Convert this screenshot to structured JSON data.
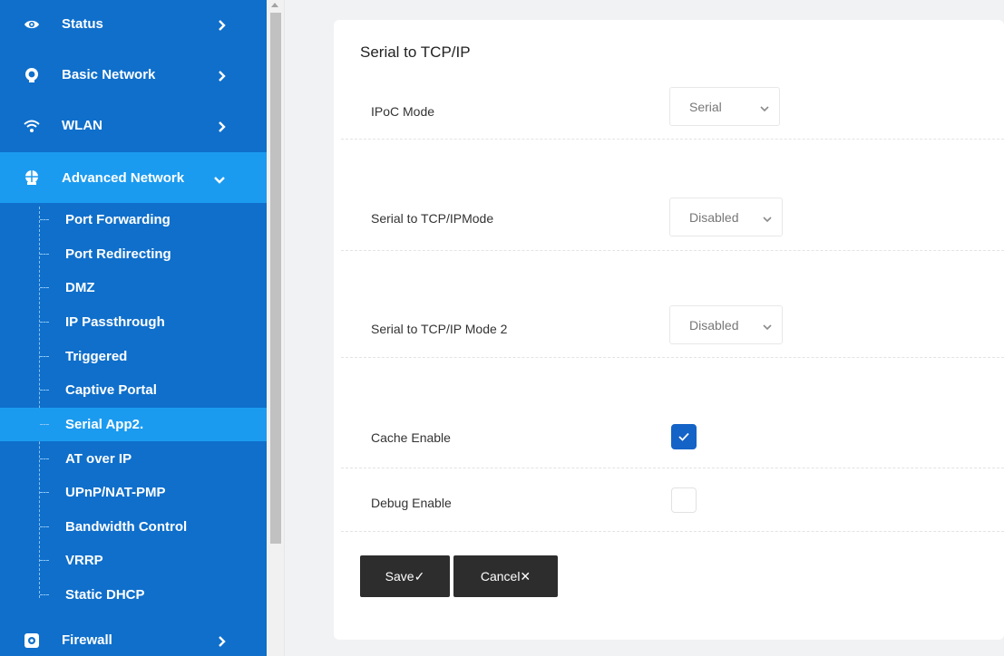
{
  "sidebar": {
    "main_items": [
      {
        "label": "Status",
        "icon": "eye-icon"
      },
      {
        "label": "Basic Network",
        "icon": "globe-icon"
      },
      {
        "label": "WLAN",
        "icon": "wifi-icon"
      },
      {
        "label": "Advanced Network",
        "icon": "network-icon",
        "expanded": true
      },
      {
        "label": "Firewall",
        "icon": "firewall-icon"
      }
    ],
    "sub_items": [
      "Port Forwarding",
      "Port Redirecting",
      "DMZ",
      "IP Passthrough",
      "Triggered",
      "Captive Portal",
      "Serial App2.",
      "AT over IP",
      "UPnP/NAT-PMP",
      "Bandwidth Control",
      "VRRP",
      "Static DHCP"
    ],
    "active_sub_item": "Serial App2."
  },
  "form": {
    "title": "Serial to TCP/IP",
    "ipoc_mode": {
      "label": "IPoC Mode",
      "value": "Serial"
    },
    "tcp_mode": {
      "label": "Serial to TCP/IPMode",
      "value": "Disabled"
    },
    "tcp_mode2": {
      "label": "Serial to TCP/IP Mode 2",
      "value": "Disabled"
    },
    "cache_enable": {
      "label": "Cache Enable",
      "checked": true
    },
    "debug_enable": {
      "label": "Debug Enable",
      "checked": false
    }
  },
  "buttons": {
    "save": "Save✓",
    "cancel": "Cancel✕"
  },
  "colors": {
    "sidebar": "#0f6fcb",
    "sidebar_active": "#1b9bf0",
    "checkbox_on": "#1463c7",
    "button": "#2d2d2d"
  }
}
